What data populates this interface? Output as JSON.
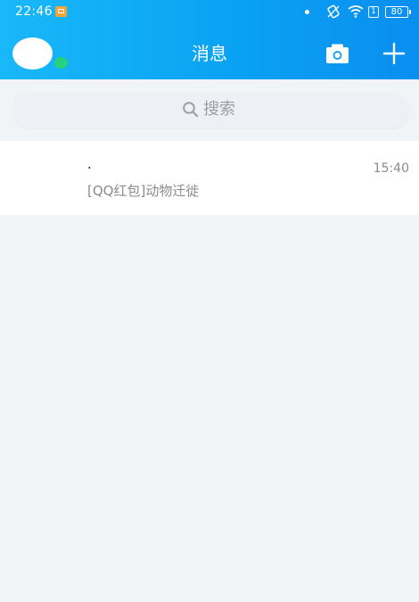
{
  "status_bar": {
    "time": "22:46",
    "sim_label": "1",
    "battery_level": "80"
  },
  "header": {
    "title": "消息",
    "icons": [
      "avatar",
      "online-status",
      "camera-icon",
      "plus-icon"
    ]
  },
  "search": {
    "placeholder": "搜索"
  },
  "conversations": [
    {
      "name": ".",
      "time": "15:40",
      "last_message": "[QQ红包]动物迁徙"
    }
  ],
  "colors": {
    "header_gradient_start": "#19b8f9",
    "header_gradient_end": "#0a8ef0",
    "online_indicator": "#27d17e",
    "background": "#f1f4f7"
  }
}
